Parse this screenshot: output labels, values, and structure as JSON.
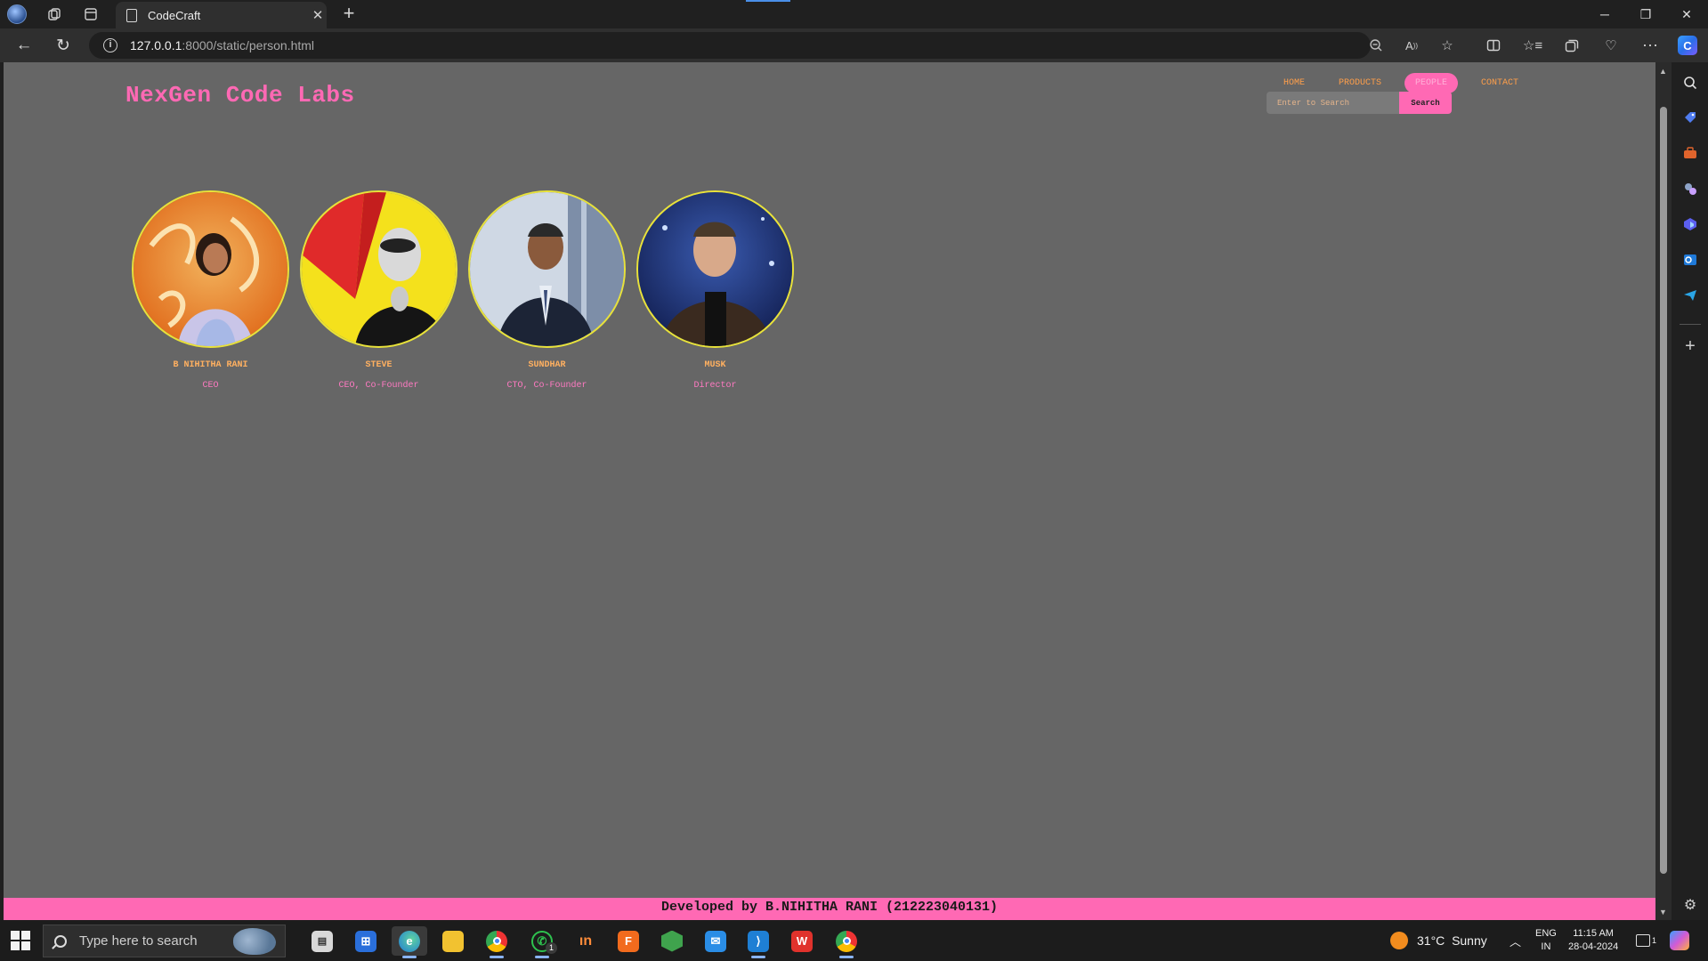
{
  "browser": {
    "tab_title": "CodeCraft",
    "tab_close": "✕",
    "new_tab": "+",
    "url_host": "127.0.0.1",
    "url_path": ":8000/static/person.html",
    "window_controls": {
      "minimize": "─",
      "restore": "❐",
      "close": "✕"
    }
  },
  "site": {
    "logo": "NexGen Code Labs",
    "nav": [
      {
        "label": "HOME"
      },
      {
        "label": "PRODUCTS"
      },
      {
        "label": "PEOPLE",
        "active": true
      },
      {
        "label": "CONTACT"
      }
    ],
    "search": {
      "placeholder": "Enter to Search",
      "button": "Search"
    },
    "people": [
      {
        "name": "B NIHITHA RANI",
        "role": "CEO"
      },
      {
        "name": "STEVE",
        "role": "CEO, Co-Founder"
      },
      {
        "name": "SUNDHAR",
        "role": "CTO, Co-Founder"
      },
      {
        "name": "MUSK",
        "role": "Director"
      }
    ],
    "footer": "Developed by B.NIHITHA RANI (212223040131)"
  },
  "taskbar": {
    "search_placeholder": "Type here to search",
    "whatsapp_badge": "1",
    "weather": {
      "temp": "31°C",
      "condition": "Sunny"
    },
    "language": {
      "line1": "ENG",
      "line2": "IN"
    },
    "clock": {
      "time": "11:15 AM",
      "date": "28-04-2024"
    },
    "notification_badge": "1"
  },
  "colors": {
    "accent_pink": "#ff69b4",
    "nav_orange": "#ff9f4a",
    "page_bg": "#666666",
    "avatar_border": "#e8e23a"
  }
}
